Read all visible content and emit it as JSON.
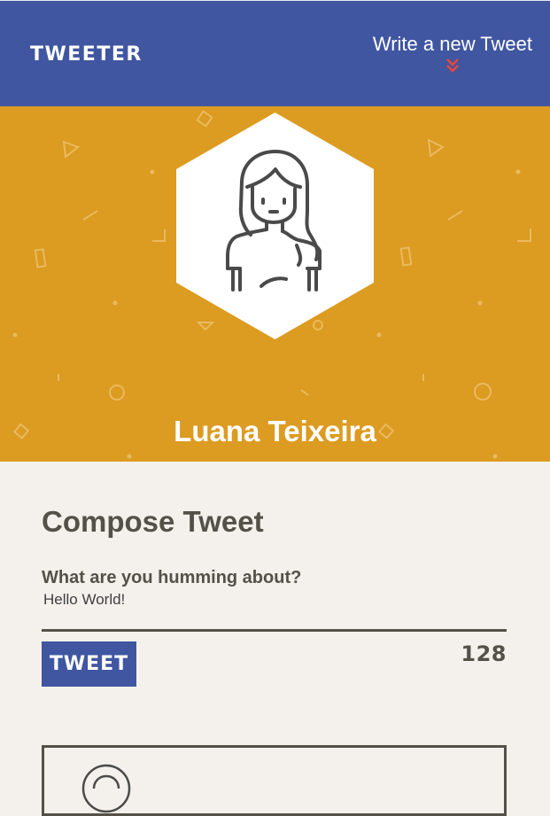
{
  "nav": {
    "brand": "TWEETER",
    "new_tweet_label": "Write a new Tweet",
    "chevron_icon": "double-chevron-down-icon",
    "accent_color": "#e8463a"
  },
  "header": {
    "profile_name": "Luana Teixeira",
    "avatar_icon": "woman-avatar-icon",
    "background_color": "#dc9b21"
  },
  "compose": {
    "title": "Compose Tweet",
    "label": "What are you humming about?",
    "text_value": "Hello World!",
    "tweet_button_label": "TWEET",
    "counter": "128"
  },
  "tweet_list": {
    "first_card_avatar_icon": "user-avatar-icon"
  },
  "colors": {
    "nav": "#4056a1",
    "page_background": "#f4f1ec",
    "text": "#545149"
  }
}
